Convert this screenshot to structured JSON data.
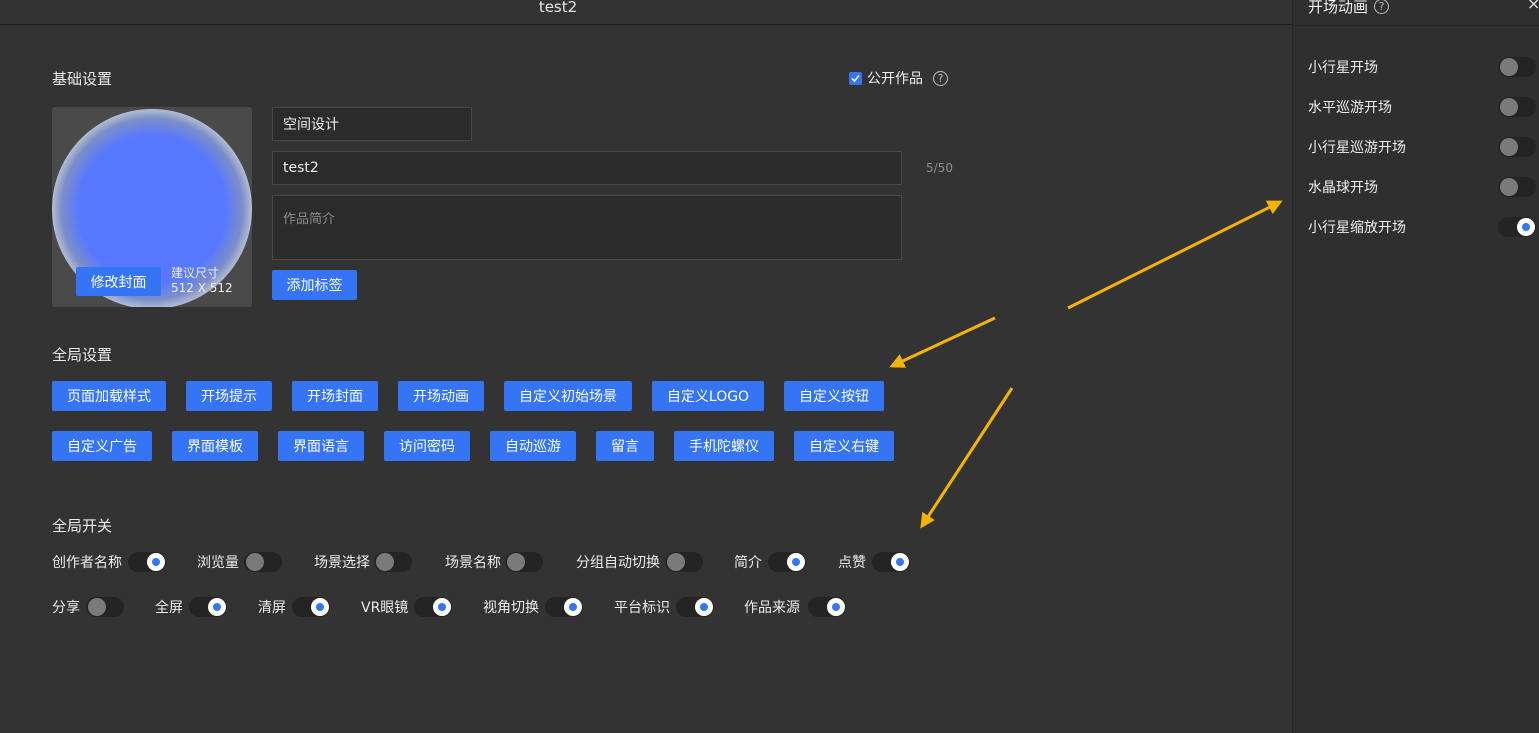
{
  "window": {
    "title": "test2"
  },
  "basic": {
    "heading": "基础设置",
    "publish_label": "公开作品",
    "publish_checked": true,
    "cover_button": "修改封面",
    "cover_hint_line1": "建议尺寸",
    "cover_hint_line2": "512 X 512",
    "category_value": "空间设计",
    "name_value": "test2",
    "name_counter": "5/50",
    "intro_placeholder": "作品简介",
    "add_tag_button": "添加标签"
  },
  "global_settings": {
    "heading": "全局设置",
    "row1": [
      "页面加载样式",
      "开场提示",
      "开场封面",
      "开场动画",
      "自定义初始场景",
      "自定义LOGO",
      "自定义按钮"
    ],
    "row2": [
      "自定义广告",
      "界面模板",
      "界面语言",
      "访问密码",
      "自动巡游",
      "留言",
      "手机陀螺仪",
      "自定义右键"
    ]
  },
  "global_switches": {
    "heading": "全局开关",
    "row1": [
      {
        "label": "创作者名称",
        "on": true
      },
      {
        "label": "浏览量",
        "on": false
      },
      {
        "label": "场景选择",
        "on": false
      },
      {
        "label": "场景名称",
        "on": false
      },
      {
        "label": "分组自动切换",
        "on": false
      },
      {
        "label": "简介",
        "on": true
      },
      {
        "label": "点赞",
        "on": true
      }
    ],
    "row2": [
      {
        "label": "分享",
        "on": false
      },
      {
        "label": "全屏",
        "on": true
      },
      {
        "label": "清屏",
        "on": true
      },
      {
        "label": "VR眼镜",
        "on": true
      },
      {
        "label": "视角切换",
        "on": true
      },
      {
        "label": "平台标识",
        "on": true
      },
      {
        "label": "作品来源",
        "on": true
      }
    ]
  },
  "panel": {
    "title": "开场动画",
    "close": "×",
    "items": [
      {
        "label": "小行星开场",
        "on": false
      },
      {
        "label": "水平巡游开场",
        "on": false
      },
      {
        "label": "小行星巡游开场",
        "on": false
      },
      {
        "label": "水晶球开场",
        "on": false
      },
      {
        "label": "小行星缩放开场",
        "on": true
      }
    ]
  },
  "colors": {
    "accent": "#3474f5",
    "background": "#333333",
    "annotation_arrow": "#f5b400"
  }
}
